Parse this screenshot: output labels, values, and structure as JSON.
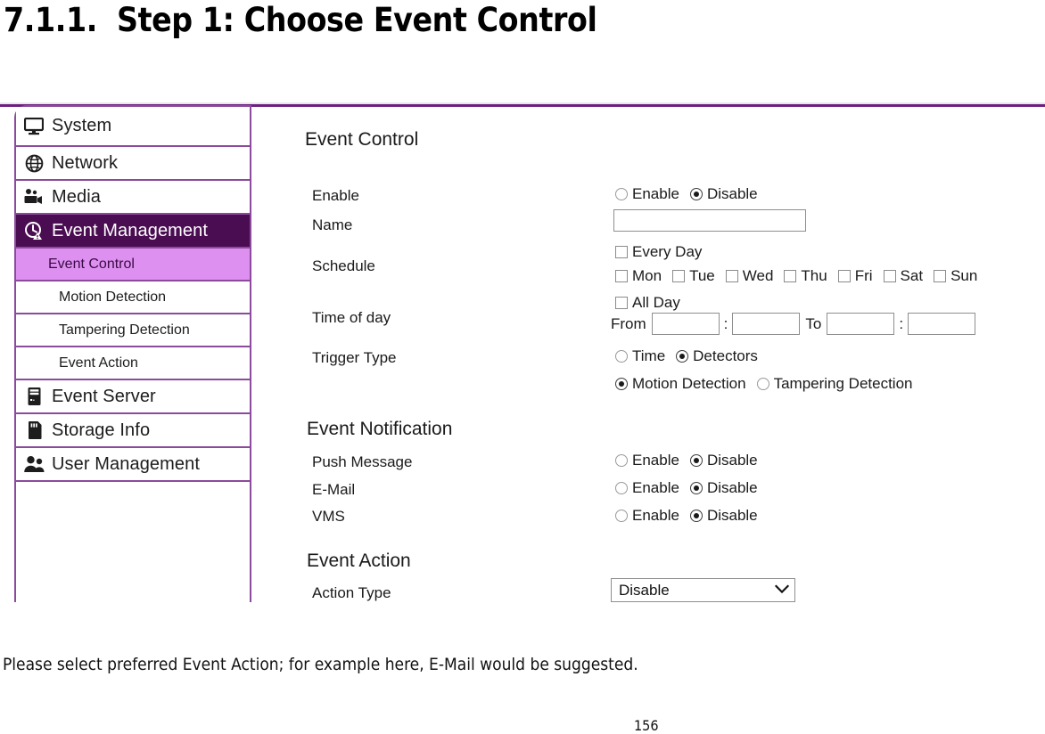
{
  "heading": {
    "number": "7.1.1.",
    "text": "Step 1: Choose Event Control"
  },
  "sidebar": {
    "items": [
      {
        "label": "System",
        "icon": "monitor-icon",
        "type": "main",
        "state": "normal"
      },
      {
        "label": "Network",
        "icon": "globe-icon",
        "type": "main",
        "state": "normal"
      },
      {
        "label": "Media",
        "icon": "video-camera-icon",
        "type": "main",
        "state": "normal"
      },
      {
        "label": "Event Management",
        "icon": "event-clock-icon",
        "type": "main",
        "state": "active"
      },
      {
        "label": "Event Control",
        "icon": "",
        "type": "sub",
        "state": "selected"
      },
      {
        "label": "Motion Detection",
        "icon": "",
        "type": "sub",
        "state": "normal"
      },
      {
        "label": "Tampering Detection",
        "icon": "",
        "type": "sub",
        "state": "normal"
      },
      {
        "label": "Event Action",
        "icon": "",
        "type": "sub",
        "state": "normal"
      },
      {
        "label": "Event Server",
        "icon": "server-icon",
        "type": "main",
        "state": "normal"
      },
      {
        "label": "Storage Info",
        "icon": "sdcard-icon",
        "type": "main",
        "state": "normal"
      },
      {
        "label": "User Management",
        "icon": "users-icon",
        "type": "main",
        "state": "normal"
      }
    ]
  },
  "panel": {
    "title": "Event Control",
    "enable": {
      "label": "Enable",
      "option_enable": "Enable",
      "option_disable": "Disable",
      "selected": "Disable"
    },
    "name": {
      "label": "Name",
      "value": "",
      "placeholder": ""
    },
    "schedule": {
      "label": "Schedule",
      "every_day": "Every Day",
      "every_day_checked": false,
      "days": [
        {
          "label": "Mon",
          "checked": false
        },
        {
          "label": "Tue",
          "checked": false
        },
        {
          "label": "Wed",
          "checked": false
        },
        {
          "label": "Thu",
          "checked": false
        },
        {
          "label": "Fri",
          "checked": false
        },
        {
          "label": "Sat",
          "checked": false
        },
        {
          "label": "Sun",
          "checked": false
        }
      ]
    },
    "time_of_day": {
      "label": "Time of day",
      "all_day": "All Day",
      "all_day_checked": false,
      "from_label": "From",
      "to_label": "To",
      "separator": ":",
      "from_hour": "",
      "from_minute": "",
      "to_hour": "",
      "to_minute": ""
    },
    "trigger_type": {
      "label": "Trigger Type",
      "option_time": "Time",
      "option_detectors": "Detectors",
      "selected_source": "Detectors",
      "option_motion": "Motion Detection",
      "option_tampering": "Tampering Detection",
      "selected_detector": "Motion Detection"
    },
    "event_notification": {
      "title": "Event Notification",
      "option_enable": "Enable",
      "option_disable": "Disable",
      "rows": [
        {
          "label": "Push Message",
          "selected": "Disable"
        },
        {
          "label": "E-Mail",
          "selected": "Disable"
        },
        {
          "label": "VMS",
          "selected": "Disable"
        }
      ]
    },
    "event_action": {
      "title": "Event Action",
      "action_type_label": "Action Type",
      "action_type_value": "Disable"
    }
  },
  "caption": "Please select preferred Event Action; for example here, E-Mail would be suggested.",
  "page_number": "156",
  "colors": {
    "accent_dark": "#4a0d52",
    "accent_light": "#dd90f0",
    "border_purple": "#8b4a9c",
    "rule_purple": "#6d2080"
  }
}
